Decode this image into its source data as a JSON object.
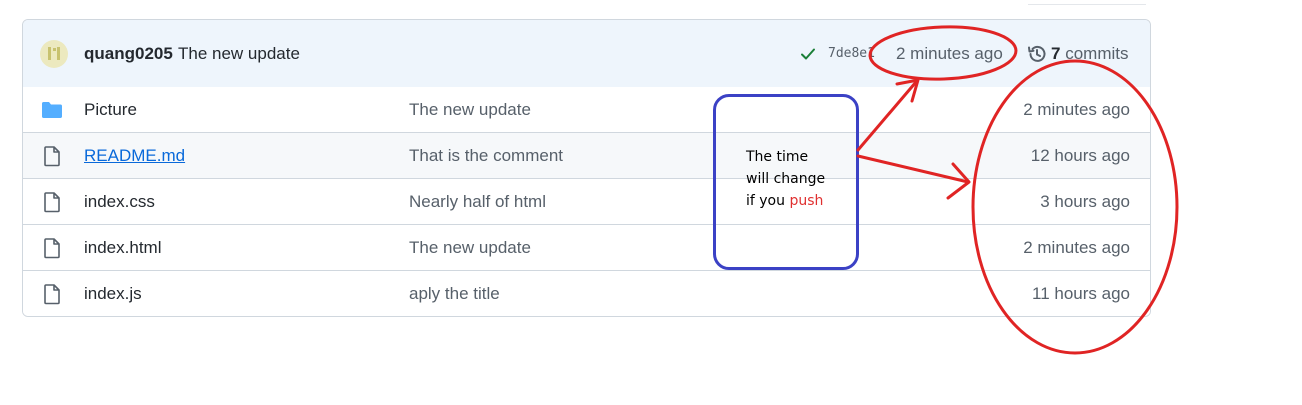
{
  "header": {
    "author": "quang0205",
    "commit_message": "The new update",
    "commit_sha": "7de8e1",
    "commit_time": "2 minutes ago",
    "commit_count": "7",
    "commit_count_label": "commits",
    "status": "success",
    "status_color": "#1a7f37"
  },
  "files": [
    {
      "icon": "folder-icon",
      "name": "Picture",
      "commit": "The new update",
      "time": "2 minutes ago"
    },
    {
      "icon": "file-icon",
      "name": "README.md",
      "commit": "That is the comment",
      "time": "12 hours ago"
    },
    {
      "icon": "file-icon",
      "name": "index.css",
      "commit": "Nearly half of html",
      "time": "3 hours ago"
    },
    {
      "icon": "file-icon",
      "name": "index.html",
      "commit": "The new update",
      "time": "2 minutes ago"
    },
    {
      "icon": "file-icon",
      "name": "index.js",
      "commit": "aply the title",
      "time": "11 hours ago"
    }
  ],
  "annotation": {
    "line1": "The time",
    "line2": "will change",
    "line3_prefix": "if you ",
    "line3_highlight": "push",
    "ink_color": "#e02424",
    "box_color": "#3b41c5"
  },
  "colors": {
    "folder": "#54aeff",
    "link": "#0969da",
    "muted": "#57606a",
    "header_bg": "#eef5fc"
  }
}
